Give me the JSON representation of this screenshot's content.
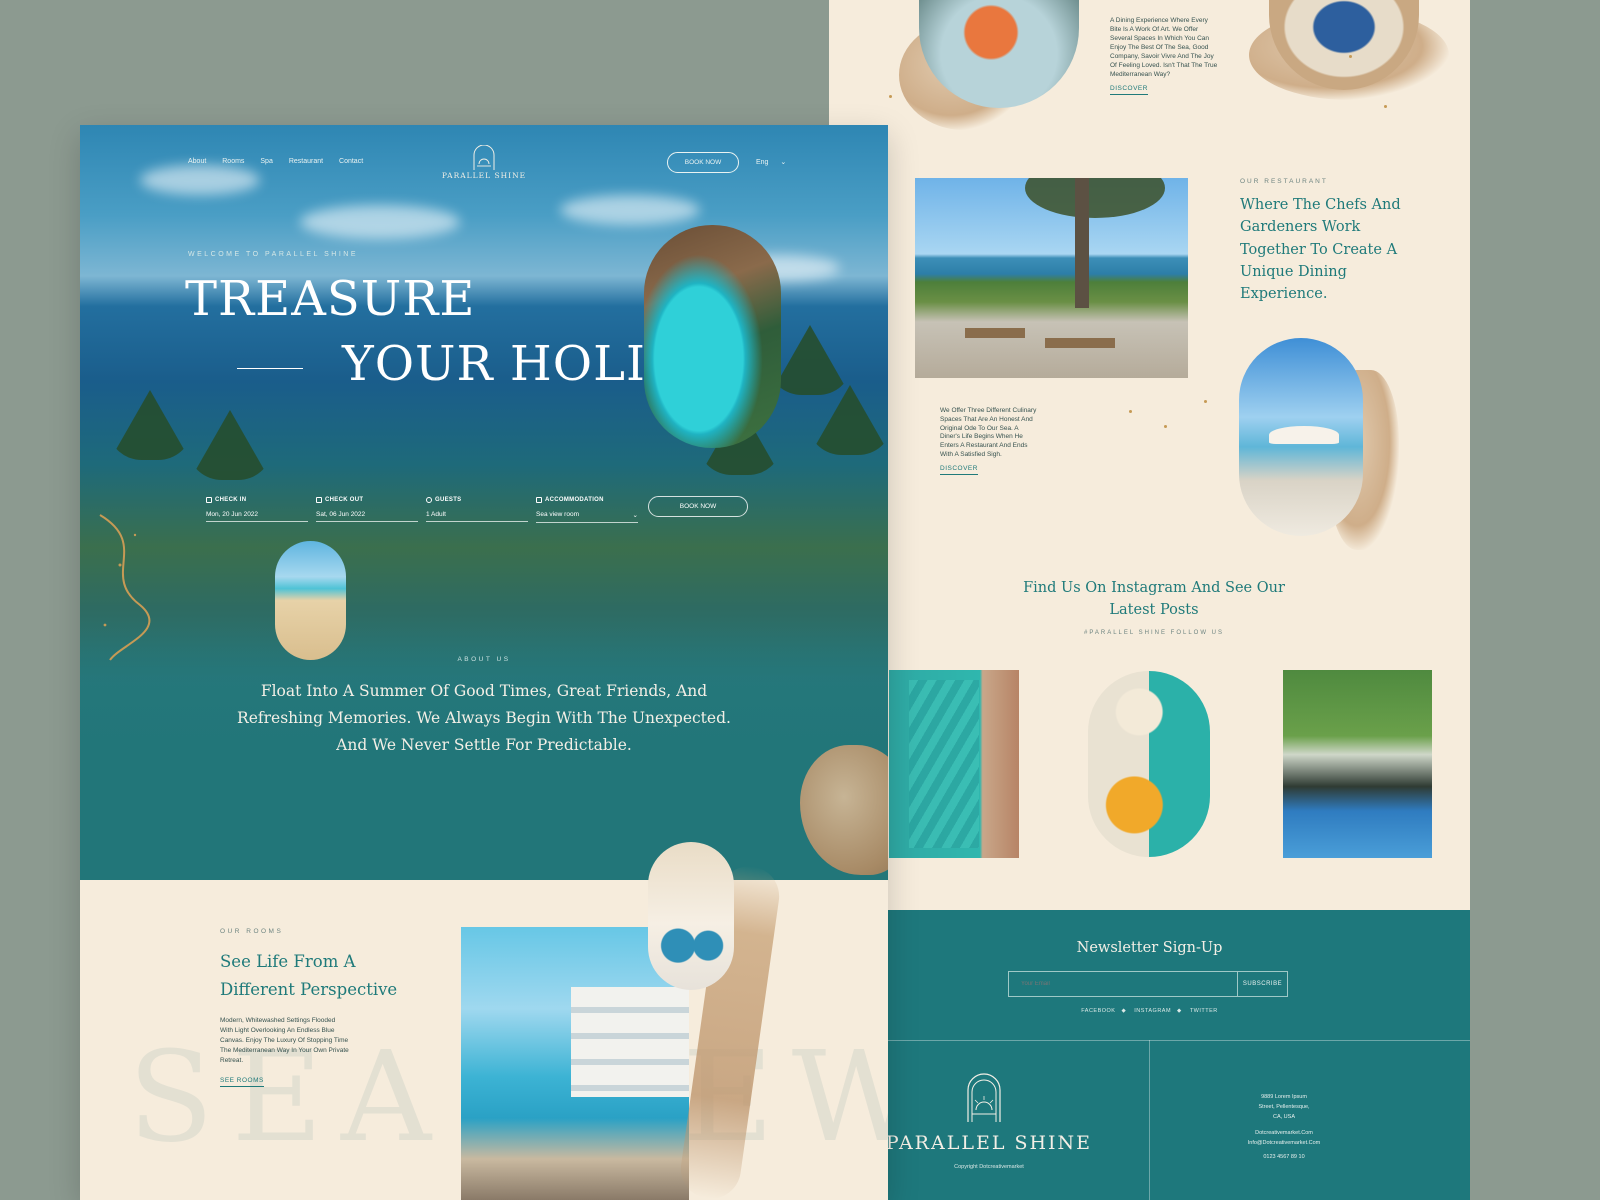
{
  "right_page": {
    "top_text": "A Dining Experience Where Every Bite Is A Work Of Art. We Offer Several Spaces In Which You Can Enjoy The Best Of The Sea, Good Company, Savoir Vivre And The Joy Of Feeling Loved. Isn't That The True Mediterranean Way?",
    "top_discover": "DISCOVER",
    "restaurant_overline": "OUR RESTAURANT",
    "restaurant_heading": "Where The Chefs And Gardeners Work Together To Create A Unique Dining Experience.",
    "dining_text": "We Offer Three Different Culinary Spaces That Are An Honest And Original Ode To Our Sea. A Diner's Life Begins When He Enters A Restaurant And Ends With A Satisfied Sigh.",
    "dining_discover": "DISCOVER",
    "instagram_title": "Find Us On Instagram And See Our Latest Posts",
    "instagram_sub": "#PARALLEL SHINE FOLLOW US",
    "newsletter_title": "Newsletter Sign-Up",
    "email_placeholder": "Your Email",
    "subscribe_label": "SUBSCRIBE",
    "social": [
      "FACEBOOK",
      "INSTAGRAM",
      "TWITTER"
    ],
    "footer_brand": "PARALLEL SHINE",
    "footer_copy": "Copyright Dotcreativemarket",
    "address_lines": [
      "9889 Lorem Ipsum",
      "Street, Pellentesque,",
      "CA, USA"
    ],
    "website": "Dotcreativemarket.Com",
    "email": "Info@Dotcreativemarket.Com",
    "phone": "0123 4567 89 10"
  },
  "left_page": {
    "nav": [
      "About",
      "Rooms",
      "Spa",
      "Restaurant",
      "Contact"
    ],
    "brand": "PARALLEL SHINE",
    "book_now_top": "BOOK NOW",
    "lang": "Eng",
    "welcome": "WELCOME TO PARALLEL SHINE",
    "hero_line1": "TREASURE",
    "hero_line2": "YOUR HOLIDAY",
    "booking": {
      "check_in_label": "CHECK IN",
      "check_in_value": "Mon, 20 Jun 2022",
      "check_out_label": "CHECK OUT",
      "check_out_value": "Sat, 06 Jun 2022",
      "guests_label": "GUESTS",
      "guests_value": "1 Adult",
      "accommodation_label": "ACCOMMODATION",
      "accommodation_value": "Sea view room",
      "button": "BOOK NOW"
    },
    "about_overline": "ABOUT US",
    "about_text": "Float Into A Summer Of Good Times, Great Friends, And Refreshing Memories. We Always Begin With The Unexpected. And We Never Settle For Predictable.",
    "rooms_overline": "OUR ROOMS",
    "rooms_title": "See Life From A Different Perspective",
    "rooms_text": "Modern, Whitewashed Settings Flooded With Light Overlooking An Endless Blue Canvas. Enjoy The Luxury Of Stopping Time The Mediterranean Way In Your Own Private Retreat.",
    "see_rooms": "SEE ROOMS",
    "watermark": "SEA VIEW"
  },
  "colors": {
    "teal": "#1e787c",
    "cream": "#f6ecdc",
    "gold": "#c69a55",
    "background": "#8c9a90"
  }
}
